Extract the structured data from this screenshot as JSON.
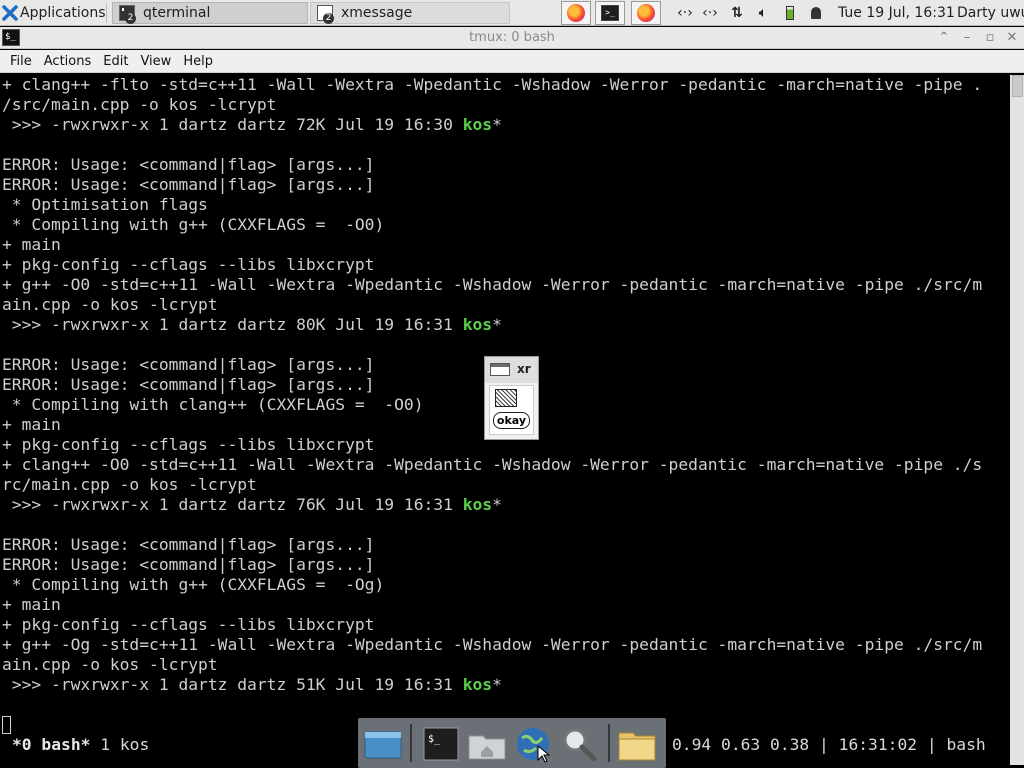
{
  "panel": {
    "applications_label": "Applications",
    "tasks": [
      {
        "label": "qterminal",
        "count": "2"
      },
      {
        "label": "xmessage",
        "count": "2"
      }
    ],
    "clock": "Tue 19 Jul, 16:31",
    "user": "Darty uwu",
    "tray_icons": [
      "network-icon",
      "network-icon",
      "transfer-icon",
      "volume-icon",
      "battery-icon",
      "notification-bell-icon"
    ]
  },
  "window": {
    "title": "tmux: 0 bash",
    "menu": [
      "File",
      "Actions",
      "Edit",
      "View",
      "Help"
    ]
  },
  "terminal": {
    "lines": [
      {
        "text": "+ clang++ -flto -std=c++11 -Wall -Wextra -Wpedantic -Wshadow -Werror -pedantic -march=native -pipe ."
      },
      {
        "text": "/src/main.cpp -o kos -lcrypt"
      },
      {
        "text": " >>> -rwxrwxr-x 1 dartz dartz 72K Jul 19 16:30 ",
        "highlight": "kos",
        "suffix": "*"
      },
      {
        "text": ""
      },
      {
        "text": "ERROR: Usage: <command|flag> [args...]"
      },
      {
        "text": "ERROR: Usage: <command|flag> [args...]"
      },
      {
        "text": " * Optimisation flags"
      },
      {
        "text": " * Compiling with g++ (CXXFLAGS =  -O0)"
      },
      {
        "text": "+ main"
      },
      {
        "text": "+ pkg-config --cflags --libs libxcrypt"
      },
      {
        "text": "+ g++ -O0 -std=c++11 -Wall -Wextra -Wpedantic -Wshadow -Werror -pedantic -march=native -pipe ./src/m"
      },
      {
        "text": "ain.cpp -o kos -lcrypt"
      },
      {
        "text": " >>> -rwxrwxr-x 1 dartz dartz 80K Jul 19 16:31 ",
        "highlight": "kos",
        "suffix": "*"
      },
      {
        "text": ""
      },
      {
        "text": "ERROR: Usage: <command|flag> [args...]"
      },
      {
        "text": "ERROR: Usage: <command|flag> [args...]"
      },
      {
        "text": " * Compiling with clang++ (CXXFLAGS =  -O0)"
      },
      {
        "text": "+ main"
      },
      {
        "text": "+ pkg-config --cflags --libs libxcrypt"
      },
      {
        "text": "+ clang++ -O0 -std=c++11 -Wall -Wextra -Wpedantic -Wshadow -Werror -pedantic -march=native -pipe ./s"
      },
      {
        "text": "rc/main.cpp -o kos -lcrypt"
      },
      {
        "text": " >>> -rwxrwxr-x 1 dartz dartz 76K Jul 19 16:31 ",
        "highlight": "kos",
        "suffix": "*"
      },
      {
        "text": ""
      },
      {
        "text": "ERROR: Usage: <command|flag> [args...]"
      },
      {
        "text": "ERROR: Usage: <command|flag> [args...]"
      },
      {
        "text": " * Compiling with g++ (CXXFLAGS =  -Og)"
      },
      {
        "text": "+ main"
      },
      {
        "text": "+ pkg-config --cflags --libs libxcrypt"
      },
      {
        "text": "+ g++ -Og -std=c++11 -Wall -Wextra -Wpedantic -Wshadow -Werror -pedantic -march=native -pipe ./src/m"
      },
      {
        "text": "ain.cpp -o kos -lcrypt"
      },
      {
        "text": " >>> -rwxrwxr-x 1 dartz dartz 51K Jul 19 16:31 ",
        "highlight": "kos",
        "suffix": "*"
      }
    ],
    "highlight_color": "#5ad249"
  },
  "tmux_status": {
    "window_active": "*0 bash*",
    "window_other": "1 kos",
    "right": "0.94 0.63 0.38 | 16:31:02 | bash"
  },
  "xmessage": {
    "title": "xr",
    "button_label": "okay"
  },
  "dock": {
    "items": [
      "show-desktop-icon",
      "terminal-icon",
      "home-folder-icon",
      "web-browser-icon",
      "search-icon",
      "folder-icon"
    ]
  }
}
